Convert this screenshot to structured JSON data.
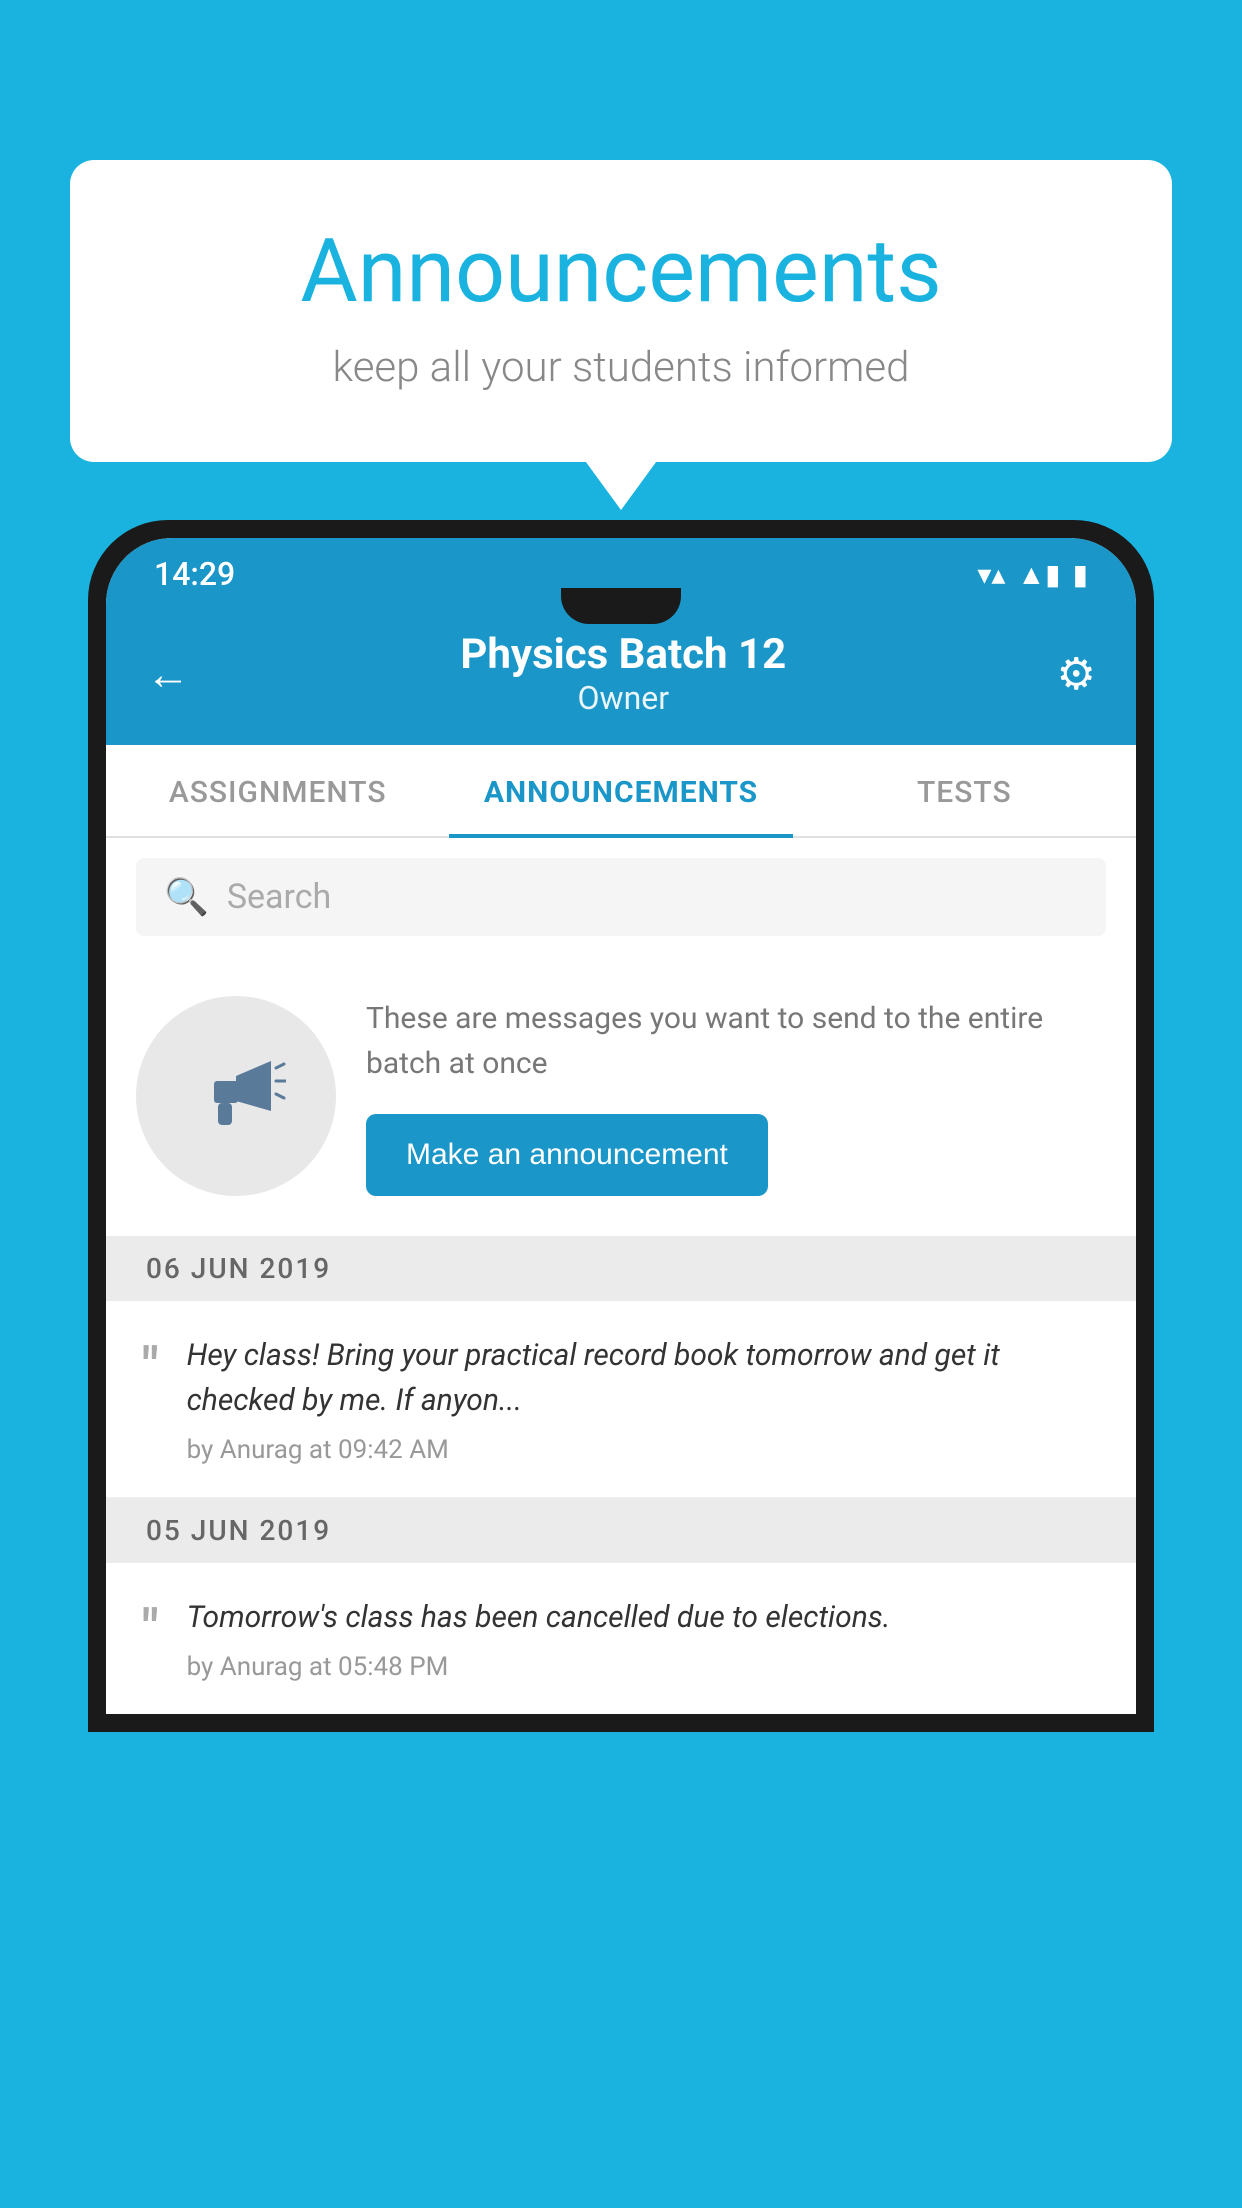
{
  "background_color": "#1ab3e0",
  "speech_bubble": {
    "title": "Announcements",
    "subtitle": "keep all your students informed"
  },
  "phone": {
    "status_bar": {
      "time": "14:29",
      "wifi": "▼▲",
      "battery": "▮"
    },
    "header": {
      "back_label": "←",
      "title": "Physics Batch 12",
      "subtitle": "Owner",
      "gear_label": "⚙"
    },
    "tabs": [
      {
        "label": "ASSIGNMENTS",
        "active": false
      },
      {
        "label": "ANNOUNCEMENTS",
        "active": true
      },
      {
        "label": "TESTS",
        "active": false
      }
    ],
    "search": {
      "placeholder": "Search"
    },
    "announcement_prompt": {
      "description": "These are messages you want to send to the entire batch at once",
      "button_label": "Make an announcement"
    },
    "announcements": [
      {
        "date": "06  JUN  2019",
        "message": "Hey class! Bring your practical record book tomorrow and get it checked by me. If anyon...",
        "meta": "by Anurag at 09:42 AM"
      },
      {
        "date": "05  JUN  2019",
        "message": "Tomorrow's class has been cancelled due to elections.",
        "meta": "by Anurag at 05:48 PM"
      }
    ]
  }
}
